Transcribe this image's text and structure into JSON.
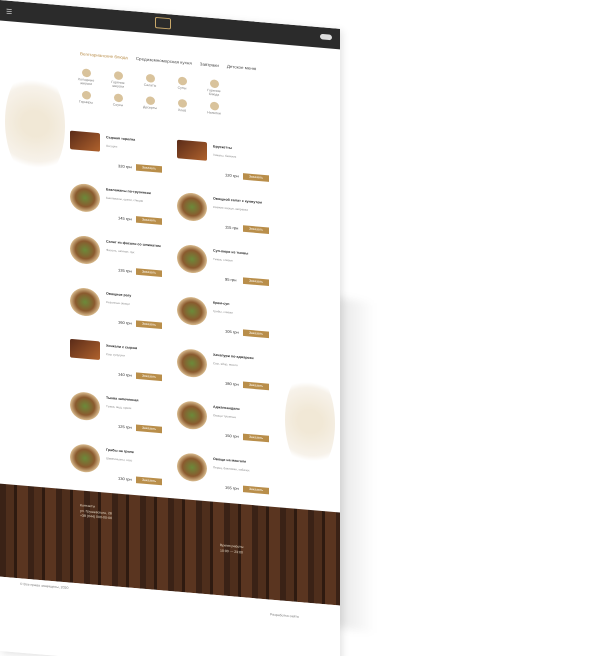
{
  "window": {
    "logo_text": "",
    "toggle": "theme-toggle"
  },
  "tabs": [
    {
      "label": "Вегетарианские блюда",
      "active": true
    },
    {
      "label": "Средиземноморская кухня",
      "active": false
    },
    {
      "label": "Завтраки",
      "active": false
    },
    {
      "label": "Детское меню",
      "active": false
    }
  ],
  "categories": [
    {
      "label": "Холодные закуски"
    },
    {
      "label": "Горячие закуски"
    },
    {
      "label": "Салаты"
    },
    {
      "label": "Супы"
    },
    {
      "label": "Горячие блюда"
    },
    {
      "label": "Гарниры"
    },
    {
      "label": "Соусы"
    },
    {
      "label": "Десерты"
    },
    {
      "label": "Хлеб"
    },
    {
      "label": "Напитки"
    }
  ],
  "menu_items": [
    {
      "name": "Сырная тарелка",
      "desc": "Ассорти",
      "price": "320 грн",
      "button": "Заказать",
      "shape": "sq"
    },
    {
      "name": "Брускетты",
      "desc": "Томаты, базилик",
      "price": "120 грн",
      "button": "Заказать",
      "shape": "sq"
    },
    {
      "name": "Баклажаны по-грузински",
      "desc": "Баклажаны, орехи, специи",
      "price": "145 грн",
      "button": "Заказать",
      "shape": "round"
    },
    {
      "name": "Овощной салат с кунжутом",
      "desc": "Свежие овощи, заправка",
      "price": "115 грн",
      "button": "Заказать",
      "shape": "round"
    },
    {
      "name": "Салат из фасоли со шпинатом",
      "desc": "Фасоль, шпинат, лук",
      "price": "135 грн",
      "button": "Заказать",
      "shape": "round"
    },
    {
      "name": "Суп-пюре из тыквы",
      "desc": "Тыква, сливки",
      "price": "95 грн",
      "button": "Заказать",
      "shape": "round"
    },
    {
      "name": "Овощное рагу",
      "desc": "Сезонные овощи",
      "price": "160 грн",
      "button": "Заказать",
      "shape": "round"
    },
    {
      "name": "Крем-суп",
      "desc": "Грибы, сливки",
      "price": "105 грн",
      "button": "Заказать",
      "shape": "round"
    },
    {
      "name": "Хинкали с сыром",
      "desc": "Сыр сулугуни",
      "price": "140 грн",
      "button": "Заказать",
      "shape": "sq"
    },
    {
      "name": "Хачапури по-аджарски",
      "desc": "Сыр, яйцо, масло",
      "price": "180 грн",
      "button": "Заказать",
      "shape": "round"
    },
    {
      "name": "Тыква запеченная",
      "desc": "Тыква, мед, орехи",
      "price": "125 грн",
      "button": "Заказать",
      "shape": "round"
    },
    {
      "name": "Аджапсандали",
      "desc": "Овощи тушеные",
      "price": "150 грн",
      "button": "Заказать",
      "shape": "round"
    },
    {
      "name": "Грибы на гриле",
      "desc": "Шампиньоны, соус",
      "price": "130 грн",
      "button": "Заказать",
      "shape": "round"
    },
    {
      "name": "Овощи на мангале",
      "desc": "Перец, баклажан, кабачок",
      "price": "155 грн",
      "button": "Заказать",
      "shape": "round"
    }
  ],
  "footer": {
    "contacts_title": "Контакты",
    "address": "ул. Грушевского, 28",
    "phone": "+38 (044) 000-00-00",
    "hours_title": "Время работы",
    "hours": "10:00 — 23:00"
  },
  "bottom": {
    "copyright": "© Все права защищены, 2020",
    "developer": "Разработка сайта"
  },
  "colors": {
    "accent": "#b98e4a",
    "topbar": "#2b2b2b",
    "wood": "#4e2e1c"
  }
}
